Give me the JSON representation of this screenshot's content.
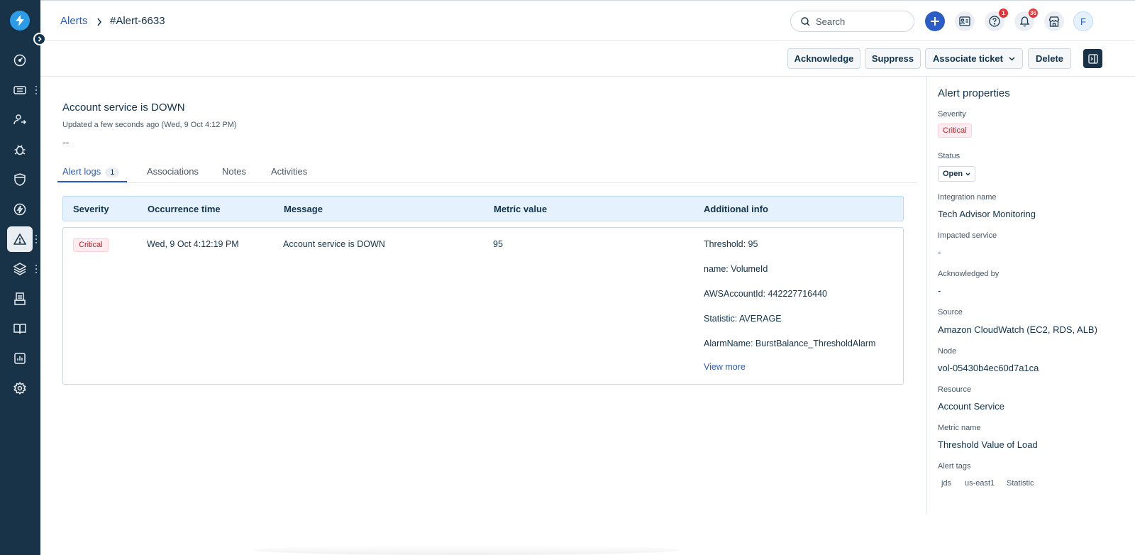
{
  "header": {
    "breadcrumb_link": "Alerts",
    "breadcrumb_current": "#Alert-6633",
    "search_placeholder": "Search",
    "help_badge": "1",
    "notifications_badge": "36",
    "avatar_initial": "F"
  },
  "toolbar": {
    "acknowledge": "Acknowledge",
    "suppress": "Suppress",
    "associate_ticket": "Associate ticket",
    "delete": "Delete"
  },
  "alert": {
    "title": "Account service is DOWN",
    "updated": "Updated a few seconds ago (Wed, 9 Oct 4:12 PM)",
    "description": "--"
  },
  "tabs": {
    "alert_logs": "Alert logs",
    "alert_logs_count": "1",
    "associations": "Associations",
    "notes": "Notes",
    "activities": "Activities"
  },
  "table": {
    "headers": {
      "severity": "Severity",
      "occurrence_time": "Occurrence time",
      "message": "Message",
      "metric_value": "Metric value",
      "additional_info": "Additional info"
    },
    "row": {
      "severity": "Critical",
      "occurrence_time": "Wed, 9 Oct 4:12:19 PM",
      "message": "Account service is DOWN",
      "metric_value": "95",
      "info": [
        "Threshold: 95",
        "name: VolumeId",
        "AWSAccountId: 442227716440",
        "Statistic: AVERAGE",
        "AlarmName: BurstBalance_ThresholdAlarm"
      ],
      "view_more": "View more"
    }
  },
  "properties": {
    "title": "Alert properties",
    "severity_label": "Severity",
    "severity_value": "Critical",
    "status_label": "Status",
    "status_value": "Open",
    "integration_label": "Integration name",
    "integration_value": "Tech Advisor Monitoring",
    "impacted_label": "Impacted service",
    "impacted_value": "-",
    "acknowledged_label": "Acknowledged by",
    "acknowledged_value": "-",
    "source_label": "Source",
    "source_value": "Amazon CloudWatch (EC2, RDS, ALB)",
    "node_label": "Node",
    "node_value": "vol-05430b4ec60d7a1ca",
    "resource_label": "Resource",
    "resource_value": "Account Service",
    "metric_label": "Metric name",
    "metric_value": "Threshold Value of Load",
    "tags_label": "Alert tags",
    "tags": [
      "jds",
      "us-east1",
      "Statistic"
    ]
  },
  "colors": {
    "sidebar": "#183247",
    "accent": "#2c5cc5",
    "critical": "#c82124"
  }
}
